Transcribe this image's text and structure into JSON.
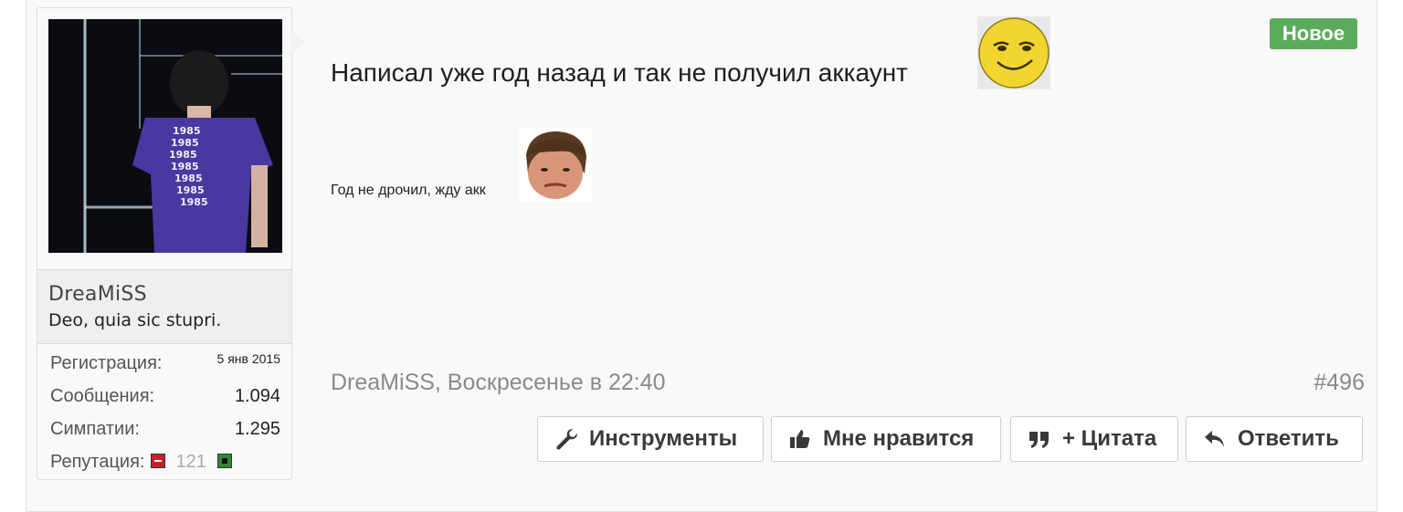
{
  "badge": "Новое",
  "user": {
    "name": "DreaMiSS",
    "title": "Deo, quia sic stupri.",
    "avatar_shirt_text": "1985"
  },
  "stats": [
    {
      "label": "Регистрация:",
      "value": "5 янв 2015"
    },
    {
      "label": "Сообщения:",
      "value": "1.094"
    },
    {
      "label": "Симпатии:",
      "value": "1.295"
    }
  ],
  "reputation": {
    "label": "Репутация:",
    "value": "121"
  },
  "post": {
    "line1": "Написал уже год назад и так не получил аккаунт",
    "line2": "Год не дрочил, жду акк",
    "meta": "DreaMiSS, Воскресенье в 22:40",
    "number": "#496"
  },
  "actions": {
    "tools": "Инструменты",
    "like": "Мне нравится",
    "quote": "+ Цитата",
    "reply": "Ответить"
  },
  "icons": {
    "tools": "wrench-icon",
    "like": "thumbs-up-icon",
    "quote": "quote-icon",
    "reply": "reply-icon"
  },
  "colors": {
    "badge_bg": "#5cab5c",
    "rep_minus": "#c8202a",
    "rep_plus": "#2e8b36"
  }
}
